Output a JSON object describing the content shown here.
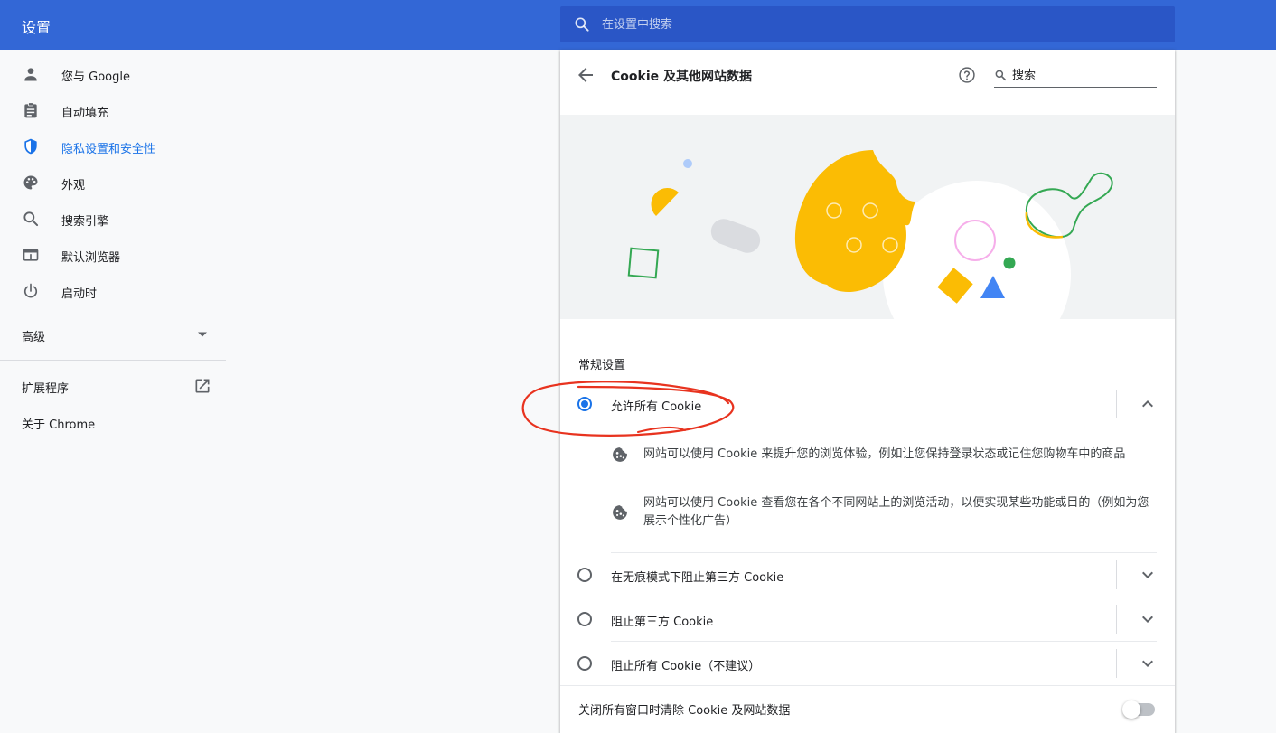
{
  "app": {
    "title": "设置"
  },
  "search": {
    "placeholder": "在设置中搜索"
  },
  "sidebar": {
    "items": [
      {
        "label": "您与 Google",
        "icon": "person-icon"
      },
      {
        "label": "自动填充",
        "icon": "clipboard-icon"
      },
      {
        "label": "隐私设置和安全性",
        "icon": "shield-icon",
        "active": true
      },
      {
        "label": "外观",
        "icon": "palette-icon"
      },
      {
        "label": "搜索引擎",
        "icon": "search-icon"
      },
      {
        "label": "默认浏览器",
        "icon": "browser-window-icon"
      },
      {
        "label": "启动时",
        "icon": "power-icon"
      }
    ],
    "advanced": "高级",
    "extensions": "扩展程序",
    "about": "关于 Chrome"
  },
  "page": {
    "title": "Cookie 及其他网站数据",
    "search_placeholder": "搜索"
  },
  "general": {
    "title": "常规设置",
    "options": [
      {
        "label": "允许所有 Cookie",
        "selected": true,
        "expanded": true
      },
      {
        "label": "在无痕模式下阻止第三方 Cookie",
        "selected": false
      },
      {
        "label": "阻止第三方 Cookie",
        "selected": false
      },
      {
        "label": "阻止所有 Cookie（不建议）",
        "selected": false
      }
    ],
    "details": [
      "网站可以使用 Cookie 来提升您的浏览体验，例如让您保持登录状态或记住您购物车中的商品",
      "网站可以使用 Cookie 查看您在各个不同网站上的浏览活动，以便实现某些功能或目的（例如为您展示个性化广告）"
    ]
  },
  "clear_on_exit": {
    "label": "关闭所有窗口时清除 Cookie 及网站数据",
    "enabled": false
  },
  "colors": {
    "header": "#3367d6",
    "search_bg": "#2a56c6",
    "accent": "#1a73e8",
    "annotation": "#e8331f"
  }
}
